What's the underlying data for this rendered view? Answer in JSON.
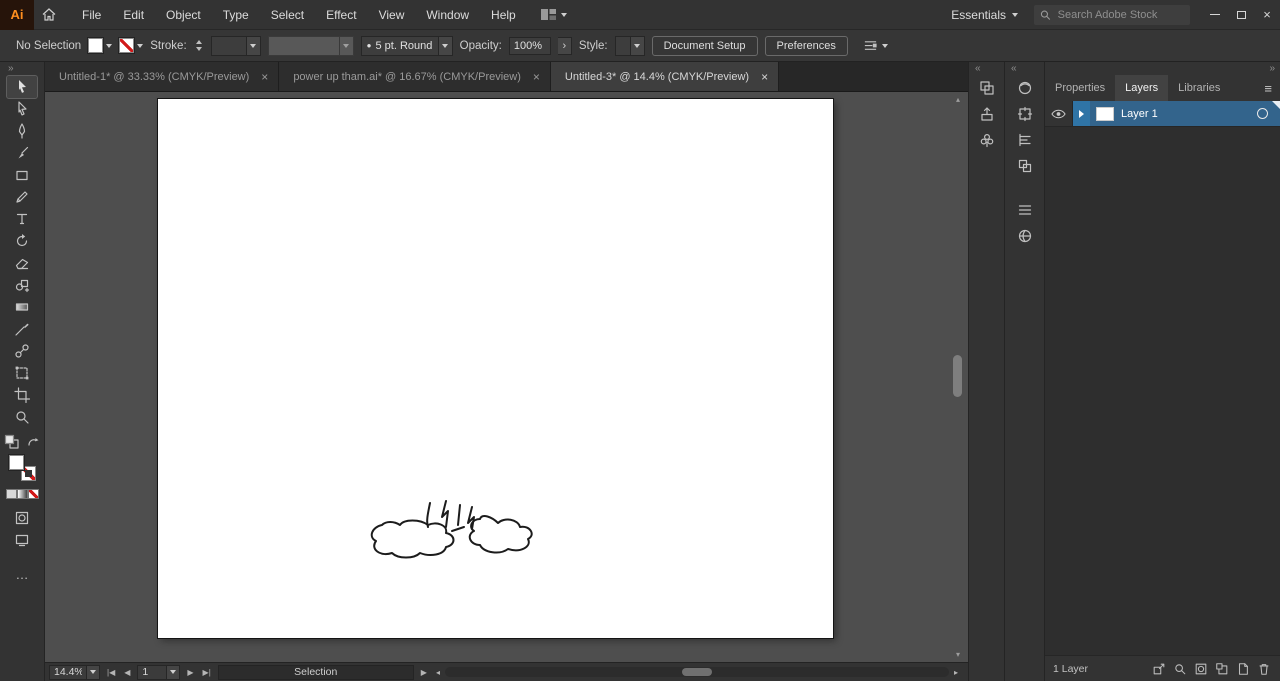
{
  "icons": {
    "close": "×",
    "expand_right": "»",
    "collapse_left": "«",
    "ellipsis": "…",
    "hamburger": "≡",
    "brush_bullet": "●",
    "first_artboard": "|◀",
    "prev_artboard": "◀",
    "next_artboard": "▶",
    "last_artboard": "▶|",
    "status_menu": "▶",
    "scroll_left": "◂",
    "scroll_right": "▸",
    "scroll_up": "▴",
    "scroll_down": "▾",
    "opacity_more": "›"
  },
  "titlebar": {
    "logo_text": "Ai",
    "menus": [
      "File",
      "Edit",
      "Object",
      "Type",
      "Select",
      "Effect",
      "View",
      "Window",
      "Help"
    ],
    "workspace_label": "Essentials",
    "search_placeholder": "Search Adobe Stock"
  },
  "controlbar": {
    "selection_status": "No Selection",
    "stroke_label": "Stroke:",
    "brush_value": "5 pt. Round",
    "opacity_label": "Opacity:",
    "opacity_value": "100%",
    "style_label": "Style:",
    "document_setup_label": "Document Setup",
    "preferences_label": "Preferences"
  },
  "document_tabs": [
    {
      "label": "Untitled-1* @ 33.33% (CMYK/Preview)"
    },
    {
      "label": "power up tham.ai* @ 16.67% (CMYK/Preview)"
    },
    {
      "label": "Untitled-3* @ 14.4% (CMYK/Preview)"
    }
  ],
  "right_panel": {
    "tabs": [
      {
        "label": "Properties"
      },
      {
        "label": "Layers"
      },
      {
        "label": "Libraries"
      }
    ],
    "layer_name": "Layer 1",
    "footer_label": "1 Layer"
  },
  "statusbar": {
    "zoom_value": "14.4%",
    "artboard_value": "1",
    "status_text": "Selection"
  }
}
